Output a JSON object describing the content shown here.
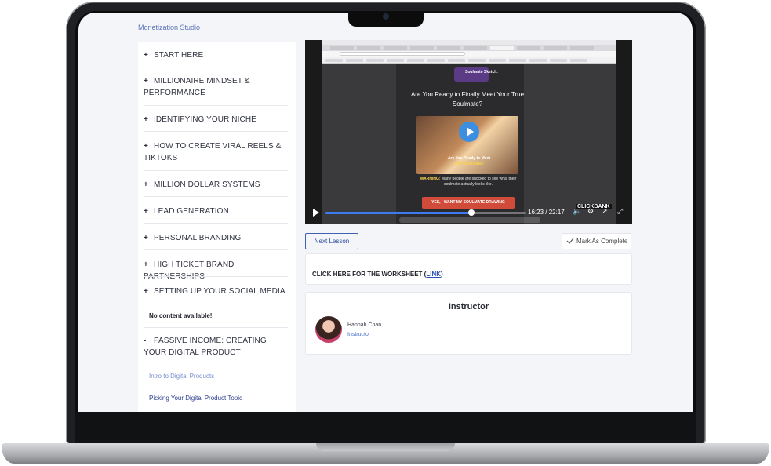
{
  "app": {
    "brand": "Monetization Studio"
  },
  "sidebar": {
    "modules": [
      {
        "prefix": "+",
        "label": "START HERE"
      },
      {
        "prefix": "+",
        "label": "MILLIONAIRE MINDSET & PERFORMANCE"
      },
      {
        "prefix": "+",
        "label": "IDENTIFYING YOUR NICHE"
      },
      {
        "prefix": "+",
        "label": "HOW TO CREATE VIRAL REELS & TIKTOKS"
      },
      {
        "prefix": "+",
        "label": "MILLION DOLLAR SYSTEMS"
      },
      {
        "prefix": "+",
        "label": "LEAD GENERATION"
      },
      {
        "prefix": "+",
        "label": "PERSONAL BRANDING"
      },
      {
        "prefix": "+",
        "label": "HIGH TICKET BRAND PARTNERSHIPS"
      },
      {
        "prefix": "+",
        "label": "SETTING UP YOUR SOCIAL MEDIA"
      },
      {
        "prefix": "-",
        "label": "PASSIVE INCOME: CREATING YOUR DIGITAL PRODUCT"
      }
    ],
    "empty_note": "No content available!",
    "lessons": [
      {
        "label": "Intro to Digital Products",
        "state": "active"
      },
      {
        "label": "Picking Your Digital Product Topic",
        "state": "normal"
      }
    ]
  },
  "video": {
    "page_logo": "Soulmate Sketch.",
    "headline": "Are You Ready to Finally Meet Your True Soulmate?",
    "thumb_caption_prefix": "Are You Ready to Meet",
    "thumb_caption_highlight": "Your Soulmate?",
    "warning_label": "WARNING:",
    "warning_text": "Many people are shocked to see what their soulmate actually looks like.",
    "cta": "YES, I WANT MY SOULMATE DRAWING",
    "badge": "CLICKBANK",
    "current_time": "16:23",
    "separator": "/",
    "duration": "22:17",
    "progress": 0.73
  },
  "actions": {
    "next_lesson": "Next Lesson",
    "mark_complete": "Mark As Complete"
  },
  "worksheet": {
    "text": "CLICK HERE FOR THE WORKSHEET",
    "open_paren": " (",
    "link_label": "LINK",
    "close_paren": ")"
  },
  "instructor": {
    "heading": "Instructor",
    "name": "Hannah Chan",
    "role": "Instructor"
  },
  "colors": {
    "accent": "#2c4b9e",
    "progress": "#3d7cf0",
    "cta": "#d14b3a"
  }
}
